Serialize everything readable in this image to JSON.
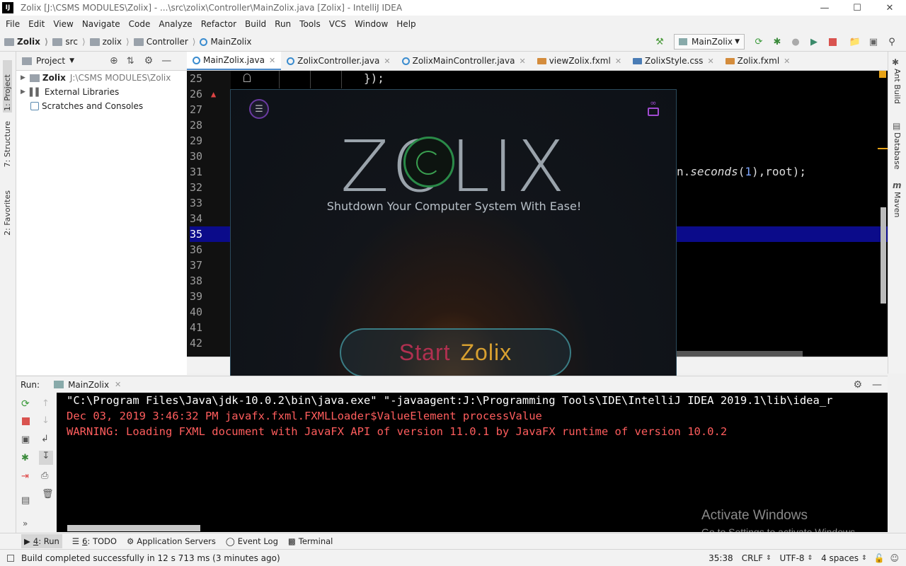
{
  "window": {
    "title": "Zolix [J:\\CSMS MODULES\\Zolix] - ...\\src\\zolix\\Controller\\MainZolix.java [Zolix] - IntelliJ IDEA",
    "logo": "IJ"
  },
  "menu": [
    "File",
    "Edit",
    "View",
    "Navigate",
    "Code",
    "Analyze",
    "Refactor",
    "Build",
    "Run",
    "Tools",
    "VCS",
    "Window",
    "Help"
  ],
  "breadcrumbs": [
    "Zolix",
    "src",
    "zolix",
    "Controller",
    "MainZolix"
  ],
  "run_config": "MainZolix",
  "left_tabs": [
    "1: Project",
    "7: Structure",
    "2: Favorites"
  ],
  "right_tabs": [
    "Ant Build",
    "Database",
    "Maven"
  ],
  "project_panel": {
    "title": "Project",
    "tree": [
      {
        "name": "Zolix",
        "path": "J:\\CSMS MODULES\\Zolix"
      },
      {
        "name": "External Libraries",
        "path": ""
      },
      {
        "name": "Scratches and Consoles",
        "path": ""
      }
    ]
  },
  "editor_tabs": [
    {
      "label": "MainZolix.java",
      "kind": "class",
      "active": true
    },
    {
      "label": "ZolixController.java",
      "kind": "class",
      "active": false
    },
    {
      "label": "ZolixMainController.java",
      "kind": "class",
      "active": false
    },
    {
      "label": "viewZolix.fxml",
      "kind": "fxml",
      "active": false
    },
    {
      "label": "ZolixStyle.css",
      "kind": "css",
      "active": false
    },
    {
      "label": "Zolix.fxml",
      "kind": "fxml",
      "active": false
    }
  ],
  "line_numbers": [
    "25",
    "26",
    "27",
    "28",
    "29",
    "30",
    "31",
    "32",
    "33",
    "34",
    "35",
    "36",
    "37",
    "38",
    "39",
    "40",
    "41",
    "42"
  ],
  "current_line": "35",
  "code": {
    "line25": "});",
    "line31_prefix": "n.",
    "line31_method": "seconds",
    "line31_open": "(",
    "line31_num": "1",
    "line31_rest": "),root);"
  },
  "zolix_app": {
    "logo": "ZOLIX",
    "subtitle": "Shutdown Your Computer System With Ease!",
    "start_word1": "Start",
    "start_word2": "Zolix"
  },
  "run_panel": {
    "label": "Run:",
    "tab": "MainZolix",
    "console": [
      {
        "text": "\"C:\\Program Files\\Java\\jdk-10.0.2\\bin\\java.exe\" \"-javaagent:J:\\Programming Tools\\IDE\\IntelliJ IDEA 2019.1\\lib\\idea_r",
        "color": "#ffffff"
      },
      {
        "text": "Dec 03, 2019 3:46:32 PM javafx.fxml.FXMLLoader$ValueElement processValue",
        "color": "#ff5d5d"
      },
      {
        "text": "WARNING: Loading FXML document with JavaFX API of version 11.0.1 by JavaFX runtime of version 10.0.2",
        "color": "#ff5d5d"
      }
    ]
  },
  "watermark": {
    "title": "Activate Windows",
    "subtitle": "Go to Settings to activate Windows."
  },
  "bottom_tabs": [
    {
      "key": "4",
      "label": ": Run"
    },
    {
      "key": "6",
      "label": ": TODO"
    },
    {
      "key": "",
      "label": "Application Servers"
    },
    {
      "key": "",
      "label": "Event Log"
    },
    {
      "key": "",
      "label": "Terminal"
    }
  ],
  "status": {
    "message": "Build completed successfully in 12 s 713 ms (3 minutes ago)",
    "position": "35:38",
    "line_sep": "CRLF",
    "encoding": "UTF-8",
    "indent": "4 spaces"
  }
}
